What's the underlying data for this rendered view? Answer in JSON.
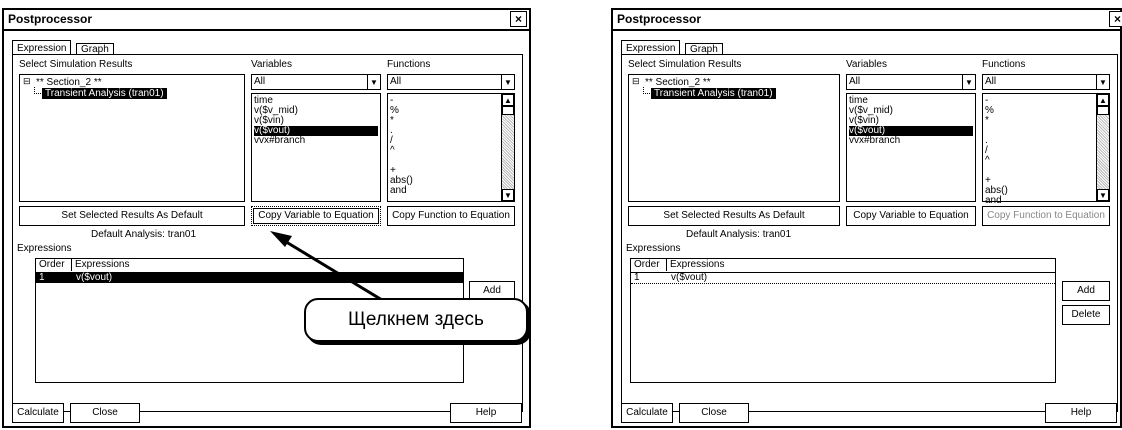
{
  "dialog": {
    "title": "Postprocessor",
    "close_glyph": "×",
    "tabs": [
      "Expression",
      "Graph"
    ]
  },
  "labels": {
    "select_results": "Select Simulation Results",
    "variables": "Variables",
    "functions": "Functions",
    "expressions": "Expressions"
  },
  "tree": {
    "expander": "⊟",
    "section": "** Section_2 **",
    "analysis": "Transient Analysis (tran01)"
  },
  "variables": {
    "filter": "All",
    "items": [
      "time",
      "v($v_mid)",
      "v($vin)",
      "v($vout)",
      "vvx#branch"
    ],
    "selected": "v($vout)"
  },
  "functions": {
    "filter": "All",
    "items": [
      "-",
      "%",
      "*",
      "",
      ".",
      "/",
      "^",
      "",
      "+",
      "abs()",
      "and"
    ]
  },
  "buttons": {
    "set_default": "Set Selected Results As Default",
    "copy_variable": "Copy Variable to Equation",
    "copy_function": "Copy Function to Equation",
    "add": "Add",
    "delete": "Delete",
    "calculate": "Calculate",
    "close": "Close",
    "help": "Help"
  },
  "default_analysis": "Default Analysis: tran01",
  "table": {
    "headers": [
      "Order",
      "Expressions"
    ],
    "rows": [
      {
        "order": "1",
        "expression": "v($vout)"
      }
    ]
  },
  "callout": {
    "text": "Щелкнем здесь"
  },
  "icons": {
    "dropdown": "▼",
    "scroll_up": "▲",
    "scroll_down": "▼"
  }
}
